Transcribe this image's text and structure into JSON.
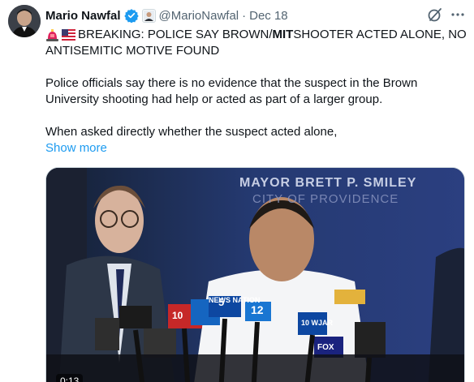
{
  "author": {
    "name": "Mario Nawfal",
    "handle": "@MarioNawfal",
    "separator": "·",
    "timestamp": "Dec 18"
  },
  "icons": {
    "verified": "verified-badge-icon",
    "affiliation": "affiliate-badge-icon",
    "grok": "grok-icon",
    "more": "more-options-icon",
    "siren": "police-siren-emoji",
    "flag": "us-flag-emoji"
  },
  "tweet": {
    "headline_prefix": "BREAKING: POLICE SAY BROWN/",
    "headline_bold": "MIT",
    "headline_suffix": " SHOOTER ACTED ALONE, NO",
    "headline_line2": "ANTISEMITIC MOTIVE FOUND",
    "paragraph1": "Police officials say there is no evidence that the suspect in the Brown University shooting had help or acted as part of a larger group.",
    "paragraph2": "When asked directly whether the suspect acted alone,",
    "show_more": "Show more"
  },
  "media": {
    "banner_line1": "MAYOR BRETT P. SMILEY",
    "banner_line2": "CITY OF PROVIDENCE",
    "duration": "0:13",
    "mic_labels": [
      "NEWS NATION",
      "12",
      "10 WJAR",
      "FOX",
      "5",
      "10"
    ]
  },
  "colors": {
    "accent": "#1d9bf0",
    "text": "#0f1419",
    "secondary": "#536471",
    "media_bg": "#1e2c52"
  }
}
